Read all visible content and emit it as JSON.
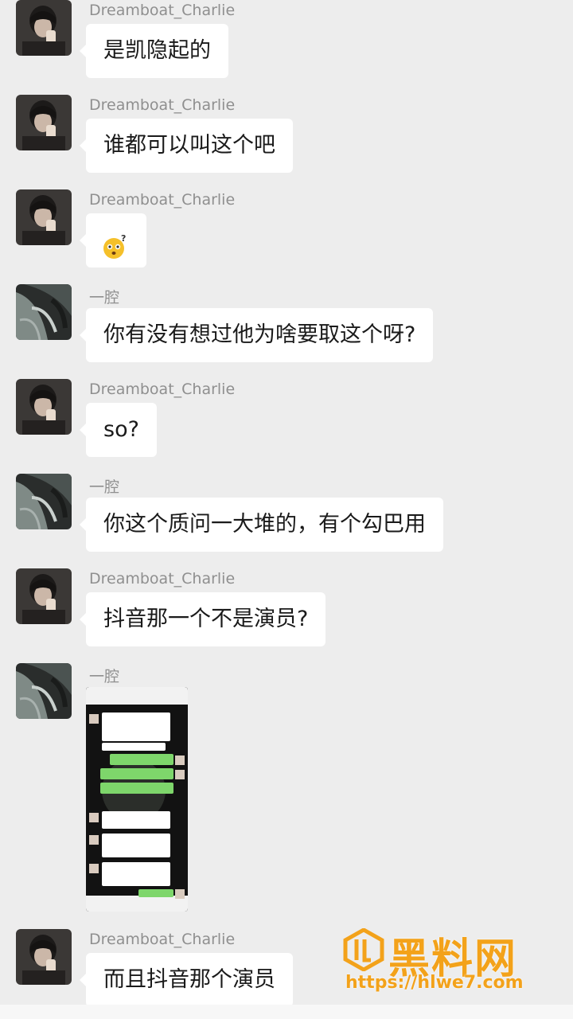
{
  "messages": [
    {
      "sender": "Dreamboat_Charlie",
      "text": "是凯隐起的",
      "avatar": "charlie-avatar"
    },
    {
      "sender": "Dreamboat_Charlie",
      "text": "谁都可以叫这个吧",
      "avatar": "charlie-avatar"
    },
    {
      "sender": "Dreamboat_Charlie",
      "text": "",
      "emoji": "confused-face-emoji",
      "avatar": "charlie-avatar"
    },
    {
      "sender": "一腔",
      "text": "你有没有想过他为啥要取这个呀?",
      "avatar": "yiqiang-avatar"
    },
    {
      "sender": "Dreamboat_Charlie",
      "text": "so?",
      "avatar": "charlie-avatar"
    },
    {
      "sender": "一腔",
      "text": "你这个质问一大堆的，有个勾巴用",
      "avatar": "yiqiang-avatar"
    },
    {
      "sender": "Dreamboat_Charlie",
      "text": "抖音那一个不是演员?",
      "avatar": "charlie-avatar"
    },
    {
      "sender": "一腔",
      "text": "",
      "image": "chat-screenshot-image",
      "avatar": "yiqiang-avatar"
    },
    {
      "sender": "Dreamboat_Charlie",
      "text": "而且抖音那个演员",
      "avatar": "charlie-avatar"
    }
  ],
  "watermark": {
    "title": "黑料网",
    "url": "https://hlwe7.com"
  },
  "colors": {
    "background": "#ededed",
    "bubble": "#ffffff",
    "sender": "#8f8f8f",
    "watermark": "#f3a21a"
  }
}
